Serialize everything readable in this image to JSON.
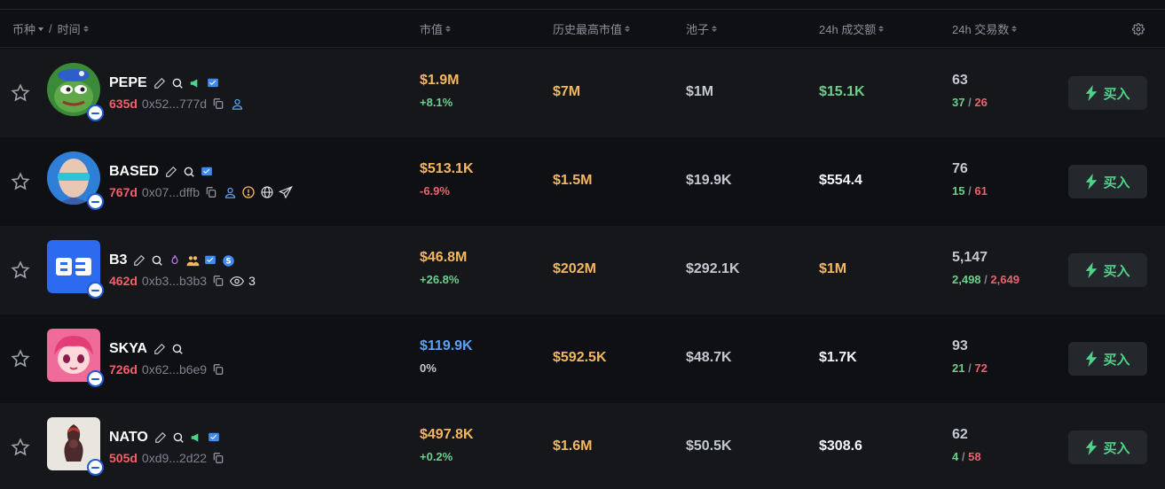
{
  "header": {
    "coin": "币种",
    "sep": "/",
    "time": "时间",
    "mcap": "市值",
    "ath": "历史最高市值",
    "pool": "池子",
    "vol": "24h 成交额",
    "txs": "24h 交易数"
  },
  "colors": {
    "background": "#0f1013",
    "row_alt": "#15171b",
    "mcap_yellow": "#f5b85c",
    "mcap_blue": "#5aa2ff",
    "green": "#6cd08a",
    "red": "#f0616d",
    "buy_green": "#4fd38a"
  },
  "rows": [
    {
      "symbol": "PEPE",
      "age": "635d",
      "addr": "0x52...777d",
      "icons": [
        "edit-icon",
        "search-icon",
        "megaphone-icon",
        "telegram-icon"
      ],
      "sub_icons": [
        "copy-icon",
        "user-icon"
      ],
      "mcap": "$1.9M",
      "mcap_change": "+8.1%",
      "ath": "$7M",
      "pool": "$1M",
      "vol": "$15.1K",
      "txs": "63",
      "buys": "37",
      "slash": "/",
      "sells": "26",
      "buy_label": "买入"
    },
    {
      "symbol": "BASED",
      "age": "767d",
      "addr": "0x07...dffb",
      "icons": [
        "edit-icon",
        "search-icon",
        "telegram-icon"
      ],
      "sub_icons": [
        "copy-icon",
        "user-icon",
        "warning-icon",
        "globe-icon",
        "send-icon"
      ],
      "mcap": "$513.1K",
      "mcap_change": "-6.9%",
      "ath": "$1.5M",
      "pool": "$19.9K",
      "vol": "$554.4",
      "txs": "76",
      "buys": "15",
      "slash": "/",
      "sells": "61",
      "buy_label": "买入"
    },
    {
      "symbol": "B3",
      "age": "462d",
      "addr": "0xb3...b3b3",
      "icons": [
        "edit-icon",
        "search-icon",
        "fire-icon",
        "people-icon",
        "telegram-icon",
        "dollar-icon"
      ],
      "sub_icons": [
        "copy-icon",
        "eye-icon"
      ],
      "watchers": "3",
      "mcap": "$46.8M",
      "mcap_change": "+26.8%",
      "ath": "$202M",
      "pool": "$292.1K",
      "vol": "$1M",
      "txs": "5,147",
      "buys": "2,498",
      "slash": "/",
      "sells": "2,649",
      "buy_label": "买入"
    },
    {
      "symbol": "SKYA",
      "age": "726d",
      "addr": "0x62...b6e9",
      "icons": [
        "edit-icon",
        "search-icon"
      ],
      "sub_icons": [
        "copy-icon"
      ],
      "mcap": "$119.9K",
      "mcap_change": "0%",
      "ath": "$592.5K",
      "pool": "$48.7K",
      "vol": "$1.7K",
      "txs": "93",
      "buys": "21",
      "slash": "/",
      "sells": "72",
      "buy_label": "买入"
    },
    {
      "symbol": "NATO",
      "age": "505d",
      "addr": "0xd9...2d22",
      "icons": [
        "edit-icon",
        "search-icon",
        "megaphone-icon",
        "telegram-icon"
      ],
      "sub_icons": [
        "copy-icon"
      ],
      "mcap": "$497.8K",
      "mcap_change": "+0.2%",
      "ath": "$1.6M",
      "pool": "$50.5K",
      "vol": "$308.6",
      "txs": "62",
      "buys": "4",
      "slash": "/",
      "sells": "58",
      "buy_label": "买入"
    }
  ]
}
